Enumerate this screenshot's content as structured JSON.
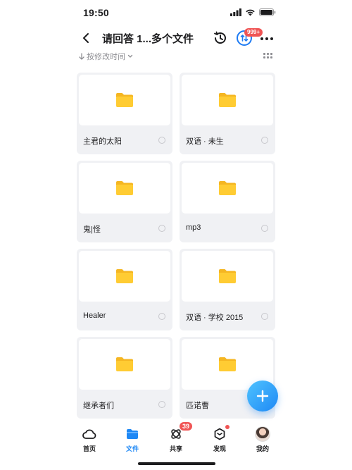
{
  "status_bar": {
    "time": "19:50"
  },
  "header": {
    "back_icon": "chevron-left-icon",
    "title": "请回答 1...多个文件",
    "history_icon": "history-icon",
    "transfer_icon": "transfer-icon",
    "transfer_badge": "999+",
    "more_icon": "more-horizontal-icon"
  },
  "sort": {
    "label": "按修改时间",
    "view_icon": "grid-view-icon"
  },
  "folders": [
    {
      "name": "主君的太阳",
      "icon": "folder-icon"
    },
    {
      "name": "双语 · 未生",
      "icon": "folder-icon"
    },
    {
      "name": "鬼|怪",
      "icon": "folder-icon"
    },
    {
      "name": "mp3",
      "icon": "folder-icon"
    },
    {
      "name": "Healer",
      "icon": "folder-icon"
    },
    {
      "name": "双语 · 学校 2015",
      "icon": "folder-icon"
    },
    {
      "name": "继承者们",
      "icon": "folder-icon"
    },
    {
      "name": "匹诺曹",
      "icon": "folder-icon"
    }
  ],
  "fab": {
    "icon": "plus-icon"
  },
  "tabs": [
    {
      "label": "首页",
      "icon": "cloud-icon"
    },
    {
      "label": "文件",
      "icon": "folder-tab-icon"
    },
    {
      "label": "共享",
      "icon": "share-icon",
      "badge": "39"
    },
    {
      "label": "发现",
      "icon": "discover-icon"
    },
    {
      "label": "我的",
      "icon": "avatar"
    }
  ],
  "colors": {
    "accent": "#1e88f5",
    "badge": "#f05454",
    "folder": "#ffcc33",
    "card_bg": "#f0f1f4"
  }
}
